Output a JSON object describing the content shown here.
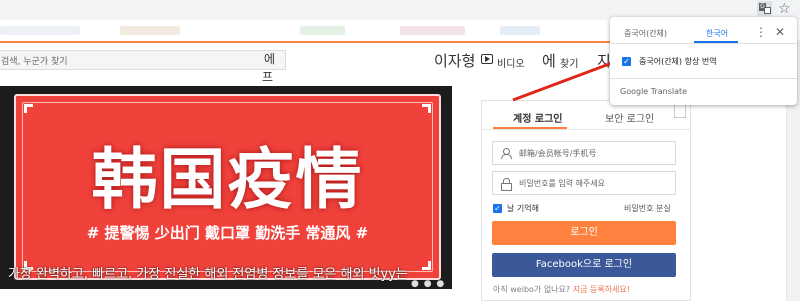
{
  "browser": {
    "translate_icon": "translate-icon",
    "star_icon": "star-icon"
  },
  "header": {
    "search_placeholder": "검색, 누군가 찾기",
    "search_overflow_1": "에",
    "search_overflow_2": "프",
    "nav_home": "이자형",
    "nav_video": "비디오",
    "nav_discover": "에",
    "nav_discover_small": "찾기",
    "nav_game": "지"
  },
  "video": {
    "headline": "韩国疫情",
    "tags": "# 提警惕 少出门 戴口罩 勤洗手 常通风 #",
    "caption": "가장 완벽하고, 빠르고, 가장 진실한 해외 전염병 정보를 모은 해외 빗yy는",
    "dots": "● ● ● ●"
  },
  "login": {
    "tab_account": "계정 로그인",
    "tab_secure": "보안 로그인",
    "username_placeholder": "邮箱/会员帐号/手机号",
    "password_placeholder": "비밀번호를 입력 해주세요",
    "remember_label": "날 기억해",
    "forgot_label": "비밀번호 분실",
    "login_button": "로그인",
    "facebook_button": "Facebook으로 로그인",
    "signup_prefix": "아직 weibo가 없나요?",
    "signup_link": "지금 등록하세요!"
  },
  "translate_popup": {
    "source_language": "중국어(간체)",
    "target_language": "한국어",
    "always_translate": "중국어(간체) 항상 번역",
    "brand": "Google Translate",
    "accent_color": "#1a73e8"
  },
  "colors": {
    "weibo_orange": "#ff8140",
    "facebook_blue": "#3b5998",
    "headline_red": "#f0413b",
    "annotation_arrow": "#e0261b"
  }
}
